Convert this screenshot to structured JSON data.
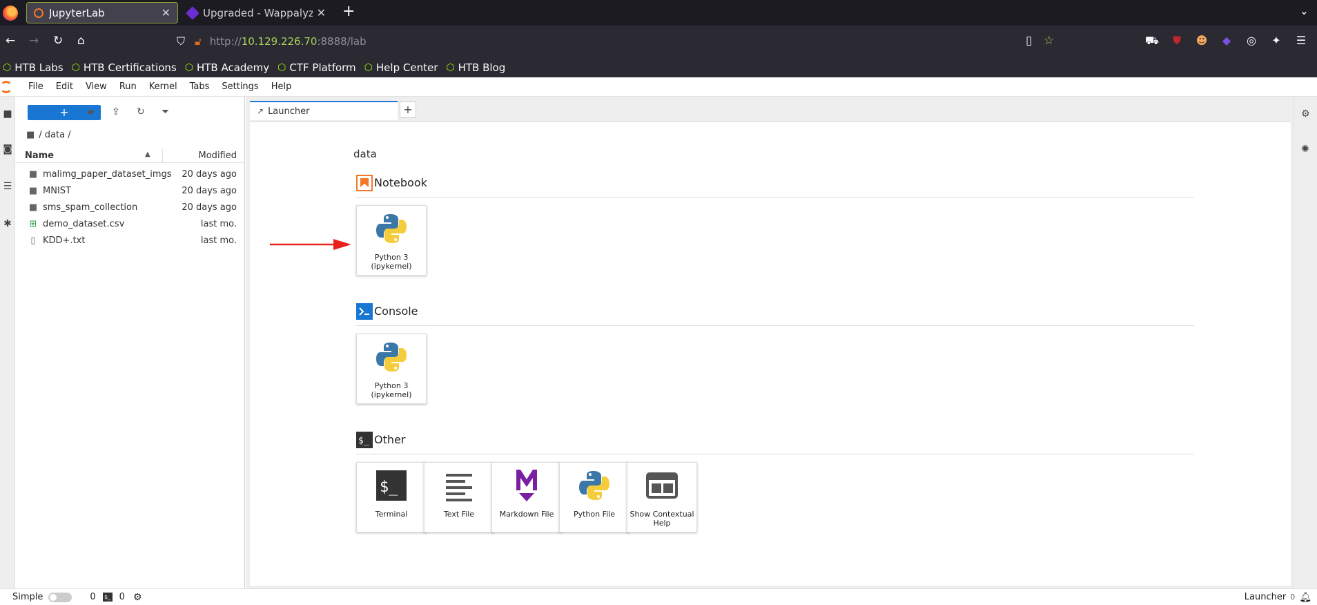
{
  "browser": {
    "tabs": [
      {
        "title": "JupyterLab",
        "active": true
      },
      {
        "title": "Upgraded - Wappalyzer",
        "active": false
      }
    ],
    "url": {
      "scheme": "http://",
      "host": "10.129.226.70",
      "rest": ":8888/lab"
    },
    "bookmarks": [
      "HTB Labs",
      "HTB Certifications",
      "HTB Academy",
      "CTF Platform",
      "Help Center",
      "HTB Blog"
    ]
  },
  "jupyter": {
    "menu": [
      "File",
      "Edit",
      "View",
      "Run",
      "Kernel",
      "Tabs",
      "Settings",
      "Help"
    ],
    "filebrowser": {
      "new_label": "+",
      "breadcrumb": "/ data /",
      "col_name": "Name",
      "col_modified": "Modified",
      "files": [
        {
          "name": "malimg_paper_dataset_imgs",
          "modified": "20 days ago",
          "type": "folder"
        },
        {
          "name": "MNIST",
          "modified": "20 days ago",
          "type": "folder"
        },
        {
          "name": "sms_spam_collection",
          "modified": "20 days ago",
          "type": "folder"
        },
        {
          "name": "demo_dataset.csv",
          "modified": "last mo.",
          "type": "csv"
        },
        {
          "name": "KDD+.txt",
          "modified": "last mo.",
          "type": "txt"
        }
      ]
    },
    "doc_tab": {
      "title": "Launcher"
    },
    "launcher": {
      "path": "data",
      "sections": {
        "notebook": {
          "title": "Notebook",
          "cards": [
            {
              "label_1": "Python 3",
              "label_2": "(ipykernel)"
            }
          ]
        },
        "console": {
          "title": "Console",
          "cards": [
            {
              "label_1": "Python 3",
              "label_2": "(ipykernel)"
            }
          ]
        },
        "other": {
          "title": "Other",
          "cards": [
            {
              "label_1": "Terminal",
              "label_2": ""
            },
            {
              "label_1": "Text File",
              "label_2": ""
            },
            {
              "label_1": "Markdown File",
              "label_2": ""
            },
            {
              "label_1": "Python File",
              "label_2": ""
            },
            {
              "label_1": "Show Contextual",
              "label_2": "Help"
            }
          ]
        }
      }
    },
    "statusbar": {
      "mode_label": "Simple",
      "kernels": "0",
      "terminals": "0",
      "right_label": "Launcher",
      "notif_count": "0"
    },
    "colors": {
      "accent": "#1976d2",
      "notebook_icon": "#f37726",
      "console_icon": "#1976d2",
      "markdown": "#7b1fa2"
    }
  }
}
